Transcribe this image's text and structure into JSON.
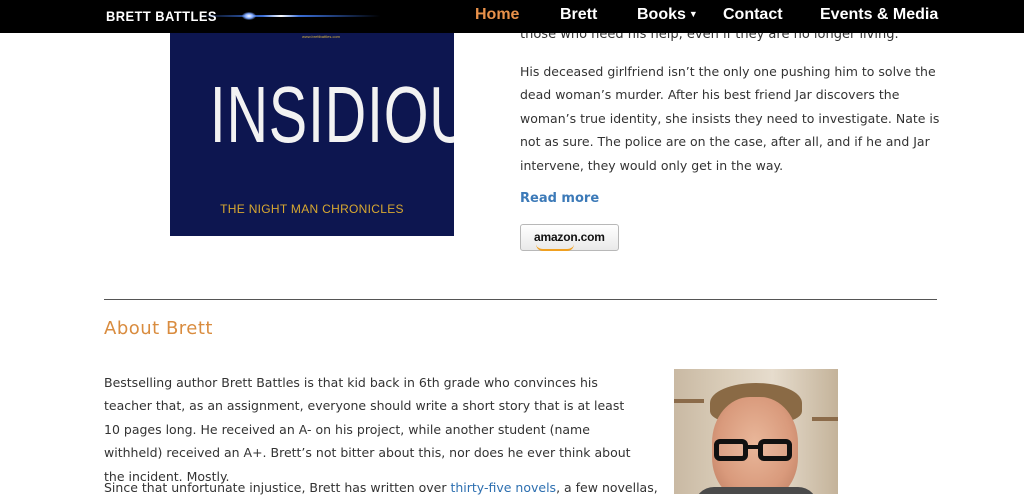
{
  "nav": {
    "logo": "BRETT BATTLES",
    "items": [
      {
        "label": "Home",
        "active": true
      },
      {
        "label": "Brett",
        "active": false
      },
      {
        "label": "Books",
        "active": false,
        "has_dropdown": true
      },
      {
        "label": "Contact",
        "active": false
      },
      {
        "label": "Events & Media",
        "active": false
      }
    ],
    "dropdown_icon": "chevron-down-icon"
  },
  "book": {
    "cover_tiny_text": "www.brettbattles.com",
    "cover_title": "INSIDIOUS",
    "cover_subtitle": "THE NIGHT MAN CHRONICLES",
    "cut_line": "those who need his help, even if they are no longer living.",
    "description": "His deceased girlfriend isn’t the only one pushing him to solve the dead woman’s murder. After his best friend Jar discovers the woman’s true identity, she insists they need to investigate. Nate is not as sure. The police are on the case, after all, and if he and Jar intervene, they would only get in the way.",
    "read_more": "Read more",
    "amazon_label": "amazon.com"
  },
  "about": {
    "heading": "About Brett",
    "paragraph1": "Bestselling author Brett Battles is that kid back in 6th grade who convinces his teacher that, as an assignment, everyone should write a short story that is at least 10 pages long. He received an A- on his project, while another student (name withheld) received an A+. Brett’s not bitter about this, nor does he ever think about the incident. Mostly.",
    "paragraph2_before": "Since that unfortunate injustice, Brett has written over ",
    "paragraph2_link": "thirty-five novels",
    "paragraph2_after": ", a few novellas,"
  },
  "colors": {
    "accent": "#e8914a",
    "heading": "#d98c3f",
    "link": "#3c7ab8",
    "cover_bg": "#0d1650",
    "cover_subtitle": "#d8a830"
  }
}
